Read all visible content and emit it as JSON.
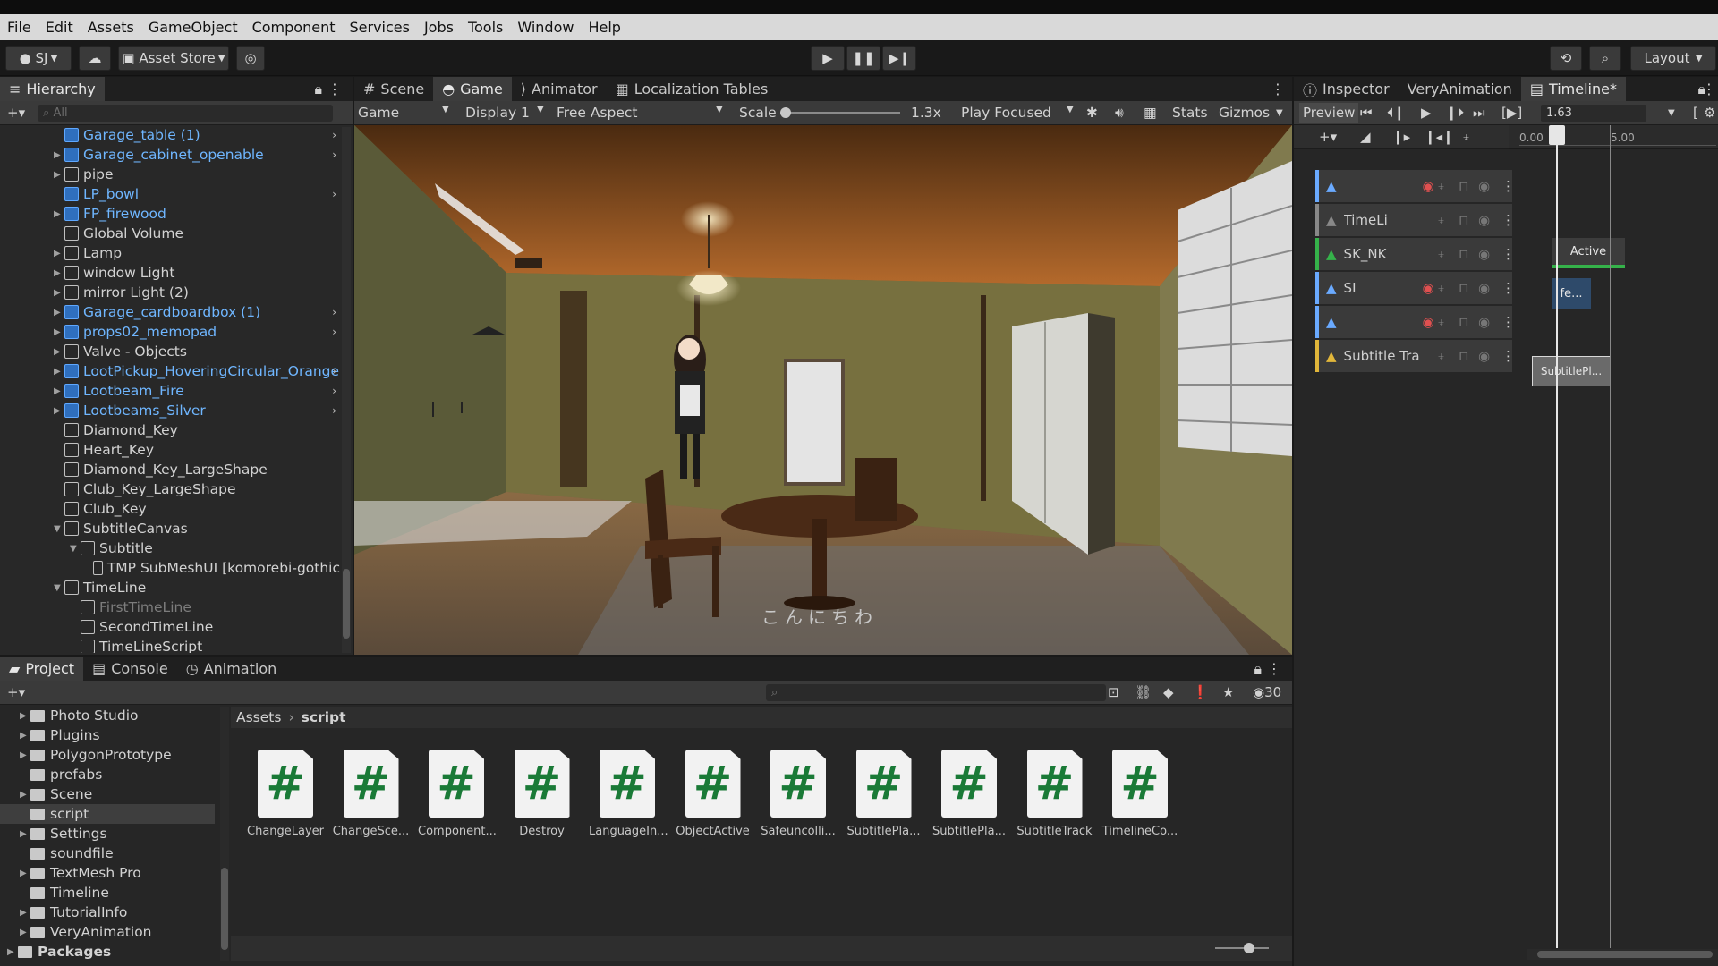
{
  "menu": [
    "File",
    "Edit",
    "Assets",
    "GameObject",
    "Component",
    "Services",
    "Jobs",
    "Tools",
    "Window",
    "Help"
  ],
  "toolbar": {
    "account": "SJ",
    "asset_store": "Asset Store",
    "layout": "Layout"
  },
  "hierarchy": {
    "title": "Hierarchy",
    "search_placeholder": "All",
    "items": [
      {
        "label": "Garage_table (1)",
        "indent": 0,
        "blue": true,
        "arrow": false,
        "right": true
      },
      {
        "label": "Garage_cabinet_openable",
        "indent": 0,
        "blue": true,
        "arrow": true,
        "right": true
      },
      {
        "label": "pipe",
        "indent": 0,
        "blue": false,
        "arrow": true,
        "right": false
      },
      {
        "label": "LP_bowl",
        "indent": 0,
        "blue": true,
        "arrow": false,
        "right": true
      },
      {
        "label": "FP_firewood",
        "indent": 0,
        "blue": true,
        "arrow": true,
        "right": false
      },
      {
        "label": "Global Volume",
        "indent": 0,
        "blue": false,
        "arrow": false,
        "right": false
      },
      {
        "label": "Lamp",
        "indent": 0,
        "blue": false,
        "arrow": true,
        "right": false
      },
      {
        "label": "window Light",
        "indent": 0,
        "blue": false,
        "arrow": true,
        "right": false
      },
      {
        "label": "mirror Light (2)",
        "indent": 0,
        "blue": false,
        "arrow": true,
        "right": false
      },
      {
        "label": "Garage_cardboardbox (1)",
        "indent": 0,
        "blue": true,
        "arrow": true,
        "right": true
      },
      {
        "label": "props02_memopad",
        "indent": 0,
        "blue": true,
        "arrow": true,
        "right": true
      },
      {
        "label": "Valve - Objects",
        "indent": 0,
        "blue": false,
        "arrow": true,
        "right": false
      },
      {
        "label": "LootPickup_HoveringCircular_Orange",
        "indent": 0,
        "blue": true,
        "arrow": true,
        "right": true
      },
      {
        "label": "Lootbeam_Fire",
        "indent": 0,
        "blue": true,
        "arrow": true,
        "right": true
      },
      {
        "label": "Lootbeams_Silver",
        "indent": 0,
        "blue": true,
        "arrow": true,
        "right": true
      },
      {
        "label": "Diamond_Key",
        "indent": 0,
        "blue": false,
        "arrow": false,
        "right": false
      },
      {
        "label": "Heart_Key",
        "indent": 0,
        "blue": false,
        "arrow": false,
        "right": false
      },
      {
        "label": "Diamond_Key_LargeShape",
        "indent": 0,
        "blue": false,
        "arrow": false,
        "right": false
      },
      {
        "label": "Club_Key_LargeShape",
        "indent": 0,
        "blue": false,
        "arrow": false,
        "right": false
      },
      {
        "label": "Club_Key",
        "indent": 0,
        "blue": false,
        "arrow": false,
        "right": false
      },
      {
        "label": "SubtitleCanvas",
        "indent": 0,
        "blue": false,
        "arrow": true,
        "open": true,
        "right": false
      },
      {
        "label": "Subtitle",
        "indent": 1,
        "blue": false,
        "arrow": true,
        "open": true,
        "right": false
      },
      {
        "label": "TMP SubMeshUI [komorebi-gothic",
        "indent": 2,
        "blue": false,
        "arrow": false,
        "right": false
      },
      {
        "label": "TimeLine",
        "indent": 0,
        "blue": false,
        "arrow": true,
        "open": true,
        "right": false
      },
      {
        "label": "FirstTimeLine",
        "indent": 1,
        "blue": false,
        "arrow": false,
        "right": false,
        "disabled": true
      },
      {
        "label": "SecondTimeLine",
        "indent": 1,
        "blue": false,
        "arrow": false,
        "right": false
      },
      {
        "label": "TimeLineScript",
        "indent": 1,
        "blue": false,
        "arrow": false,
        "right": false
      }
    ]
  },
  "center_tabs": [
    "Scene",
    "Game",
    "Animator",
    "Localization Tables"
  ],
  "game_bar": {
    "mode": "Game",
    "display": "Display 1",
    "aspect": "Free Aspect",
    "scale_label": "Scale",
    "scale_value": "1.3x",
    "play_mode": "Play Focused",
    "stats": "Stats",
    "gizmos": "Gizmos"
  },
  "game_view": {
    "subtitle": "こんにちわ"
  },
  "right_tabs": [
    "Inspector",
    "VeryAnimation",
    "Timeline*"
  ],
  "timeline": {
    "preview": "Preview",
    "frame": "1.63",
    "time_start": "0.00",
    "time_end": "5.00",
    "playhead_label": "1.63",
    "tracks": [
      {
        "label": "",
        "color": "#6aaaff",
        "record": true
      },
      {
        "label": "TimeLi",
        "color": "#888888",
        "record": false
      },
      {
        "label": "SK_NK",
        "color": "#35b24a",
        "record": false
      },
      {
        "label": "SI",
        "color": "#6aaaff",
        "record": true
      },
      {
        "label": "",
        "color": "#6aaaff",
        "record": true
      },
      {
        "label": "Subtitle Track",
        "color": "#e1b63a",
        "record": false
      }
    ],
    "clip_active": "Active",
    "clip_fe": "fe...",
    "clip_subtitle": "SubtitlePl..."
  },
  "bottom_tabs": [
    "Project",
    "Console",
    "Animation"
  ],
  "project": {
    "count": "30",
    "folders": [
      {
        "label": "Photo Studio",
        "arrow": true
      },
      {
        "label": "Plugins",
        "arrow": true
      },
      {
        "label": "PolygonPrototype",
        "arrow": true
      },
      {
        "label": "prefabs",
        "arrow": false
      },
      {
        "label": "Scene",
        "arrow": true
      },
      {
        "label": "script",
        "arrow": false,
        "selected": true
      },
      {
        "label": "Settings",
        "arrow": true
      },
      {
        "label": "soundfile",
        "arrow": false
      },
      {
        "label": "TextMesh Pro",
        "arrow": true
      },
      {
        "label": "Timeline",
        "arrow": false
      },
      {
        "label": "TutorialInfo",
        "arrow": true
      },
      {
        "label": "VeryAnimation",
        "arrow": true
      }
    ],
    "packages": "Packages",
    "breadcrumb": [
      "Assets",
      "script"
    ],
    "assets": [
      "ChangeLayer",
      "ChangeSce...",
      "Component...",
      "Destroy",
      "LanguageIn...",
      "ObjectActive",
      "Safeuncolli...",
      "SubtitlePla...",
      "SubtitlePla...",
      "SubtitleTrack",
      "TimelineCo..."
    ]
  }
}
